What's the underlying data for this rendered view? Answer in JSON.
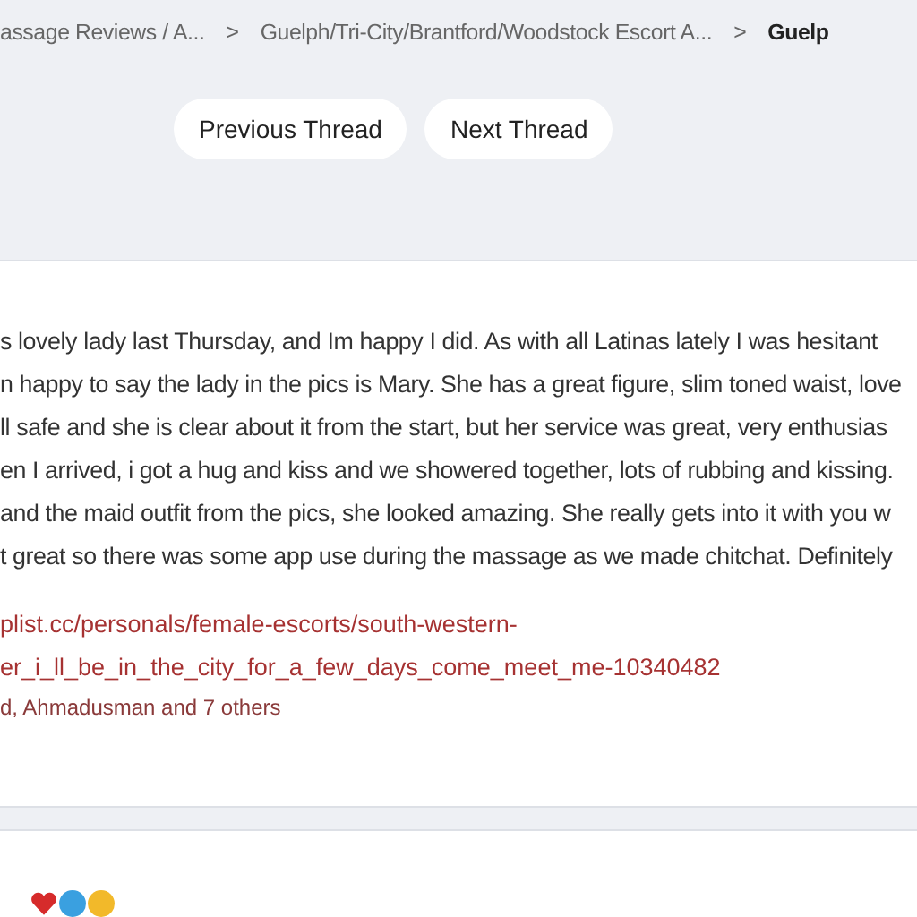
{
  "breadcrumbs": [
    {
      "label": "assage Reviews / A...",
      "current": false
    },
    {
      "label": "Guelph/Tri-City/Brantford/Woodstock Escort A...",
      "current": false
    },
    {
      "label": "Guelp",
      "current": true
    }
  ],
  "separator": ">",
  "thread_buttons": [
    "Previous Thread",
    "Next Thread"
  ],
  "post": {
    "lines": [
      "s lovely lady last Thursday, and Im happy I did. As with all Latinas lately I was hesitant",
      "n happy to say the lady in the pics is Mary. She has a great figure, slim toned waist, love",
      "ll safe and she is clear about it from the start, but her service was great, very enthusias",
      "en I arrived, i got a hug and kiss and we showered together, lots of rubbing and kissing.",
      "and the maid outfit from the pics, she looked amazing. She really gets into it with you w",
      "t great so there was some app use during the massage as we made chitchat. Definitely"
    ],
    "link_lines": [
      "plist.cc/personals/female-escorts/south-western-",
      "er_i_ll_be_in_the_city_for_a_few_days_come_meet_me-10340482"
    ],
    "likes": "d, Ahmadusman and 7 others"
  },
  "next_post": {
    "reactions": [
      {
        "kind": "heart"
      },
      {
        "kind": "blue"
      },
      {
        "kind": "laugh"
      }
    ]
  }
}
